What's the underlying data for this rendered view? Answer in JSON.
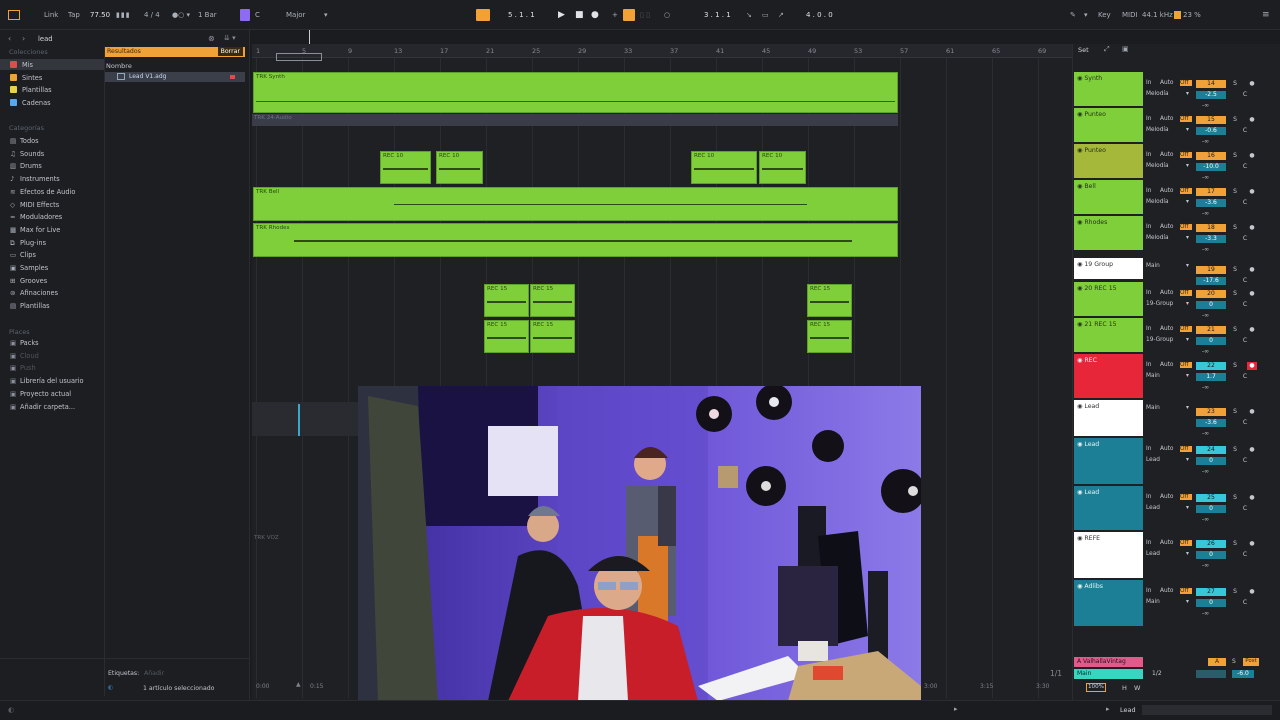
{
  "topbar": {
    "link": "Link",
    "tap": "Tap",
    "tempo": "77.50",
    "meter": "4 / 4",
    "quantize": "1 Bar",
    "key": "C",
    "scale": "Major",
    "position": "5 . 1 . 1",
    "loop_start": "3 . 1 . 1",
    "loop_length": "4 . 0 . 0",
    "key_label": "Key",
    "midi_label": "MIDI",
    "sample_rate": "44.1 kHz",
    "cpu": "23 %"
  },
  "browser": {
    "search": "lead",
    "collections_label": "Colecciones",
    "collections": [
      {
        "label": "Mis",
        "color": "#e04b4b"
      },
      {
        "label": "Sintes",
        "color": "#f0a238"
      },
      {
        "label": "Plantillas",
        "color": "#e8d24a"
      },
      {
        "label": "Cadenas",
        "color": "#56a8f0"
      }
    ],
    "categories_label": "Categorías",
    "categories": [
      "Todos",
      "Sounds",
      "Drums",
      "Instruments",
      "Efectos de Audio",
      "MIDI Effects",
      "Moduladores",
      "Max for Live",
      "Plug-ins",
      "Clips",
      "Samples",
      "Grooves",
      "Afinaciones",
      "Plantillas"
    ],
    "places_label": "Places",
    "places": [
      "Packs",
      "Cloud",
      "Push",
      "Librería del usuario",
      "Proyecto actual",
      "Añadir carpeta..."
    ],
    "results_label": "Resultados",
    "clear_label": "Borrar",
    "col_name": "Nombre",
    "result": "Lead V1.adg",
    "tags_label": "Etiquetas:",
    "tags_add": "Añadir",
    "status": "1 artículo seleccionado"
  },
  "ruler": [
    "1",
    "5",
    "9",
    "13",
    "17",
    "21",
    "25",
    "29",
    "33",
    "37",
    "41",
    "45",
    "49",
    "53",
    "57",
    "61",
    "65",
    "69"
  ],
  "time": {
    "a": "0:00",
    "b": "0:15",
    "c": "3:00",
    "d": "3:15",
    "e": "3:30"
  },
  "arrangement": {
    "trk_synth": "TRK Synth",
    "trk_audio": "TRK 24-Audio",
    "trk_bell": "TRK Bell",
    "trk_rhodes": "TRK Rhodes",
    "trk_voz": "TRK VOZ",
    "rec10": "REC 10",
    "rec15": "REC 15",
    "page": "1/1"
  },
  "mixer": {
    "set_label": "Set",
    "tracks": [
      {
        "name": "Synth",
        "num": "14",
        "vol": "-2.5",
        "route": "Melodía",
        "color": "#7fcf3b"
      },
      {
        "name": "Punteo",
        "num": "15",
        "vol": "-0.6",
        "route": "Melodía",
        "color": "#7fcf3b"
      },
      {
        "name": "Punteo",
        "num": "16",
        "vol": "-10.0",
        "route": "Melodía",
        "color": "#a6b83a"
      },
      {
        "name": "Bell",
        "num": "17",
        "vol": "-3.6",
        "route": "Melodía",
        "color": "#7fcf3b"
      },
      {
        "name": "Rhodes",
        "num": "18",
        "vol": "-3.3",
        "route": "Melodía",
        "color": "#7fcf3b"
      },
      {
        "name": "19 Group",
        "num": "19",
        "vol": "-17.6",
        "route": "Main",
        "color": "#ffffff"
      },
      {
        "name": "20 REC 15",
        "num": "20",
        "vol": "0",
        "route": "19-Group",
        "color": "#7fcf3b"
      },
      {
        "name": "21 REC 15",
        "num": "21",
        "vol": "0",
        "route": "19-Group",
        "color": "#7fcf3b"
      },
      {
        "name": "REC",
        "num": "22",
        "vol": "1.7",
        "route": "Main",
        "color": "#e8263a"
      },
      {
        "name": "Lead",
        "num": "23",
        "vol": "-3.6",
        "route": "Main",
        "color": "#ffffff"
      },
      {
        "name": "Lead",
        "num": "24",
        "vol": "0",
        "route": "Lead",
        "color": "#1c7f95"
      },
      {
        "name": "Lead",
        "num": "25",
        "vol": "0",
        "route": "Lead",
        "color": "#1c7f95"
      },
      {
        "name": "REFE",
        "num": "26",
        "vol": "0",
        "route": "Lead",
        "color": "#ffffff"
      },
      {
        "name": "Adlibs",
        "num": "27",
        "vol": "0",
        "route": "Main",
        "color": "#1c7f95"
      }
    ],
    "labels": {
      "in": "In",
      "auto": "Auto",
      "off": "Off",
      "s": "S",
      "c": "C",
      "inf": "-∞"
    },
    "return_a": "A ValhallaVintag",
    "main": "Main",
    "main_route": "1/2",
    "main_vol": "-6.0",
    "post": "Post",
    "a_label": "A",
    "tempo_pct": "100%",
    "h": "H",
    "w": "W"
  },
  "bottombar": {
    "track": "Lead"
  },
  "colors": {
    "clip": "#7fcf3b",
    "accent": "#f0a238",
    "mixer_blue": "#1c7f95",
    "rec": "#e8263a"
  }
}
